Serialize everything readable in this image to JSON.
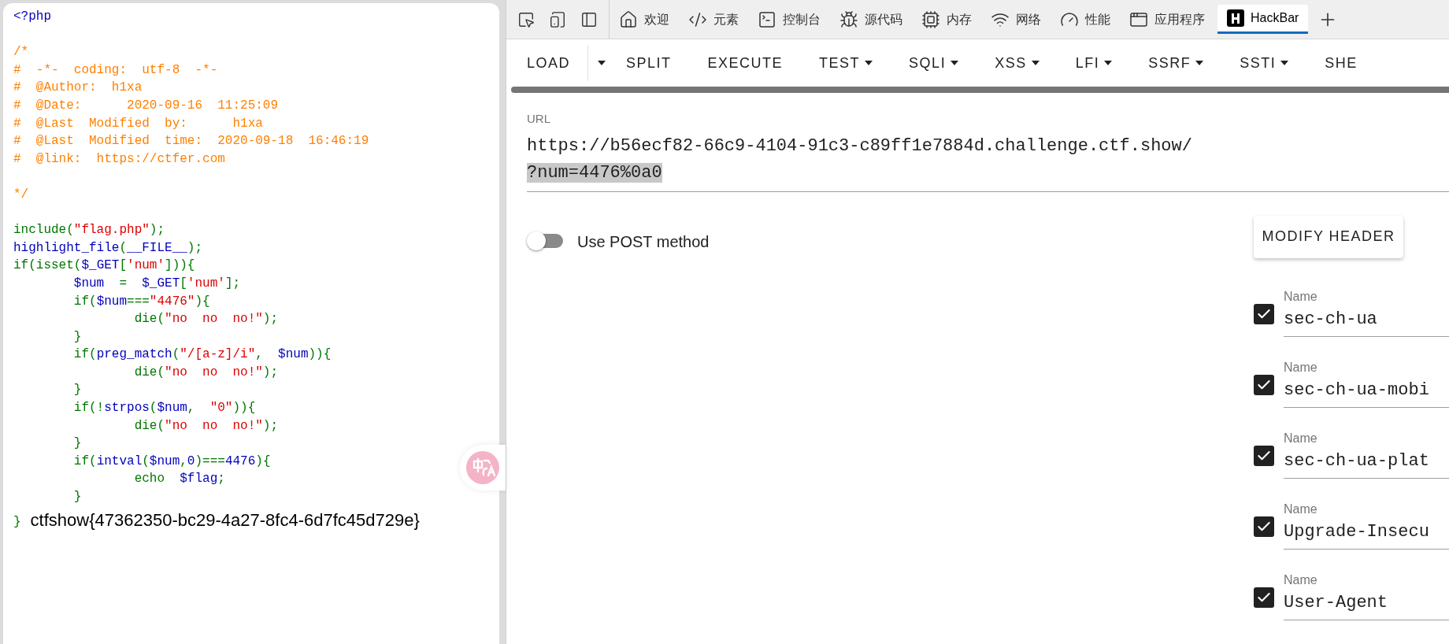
{
  "source": {
    "lines": [
      {
        "kind": "code",
        "tokens": [
          {
            "t": "<?php",
            "kind": "html"
          }
        ]
      },
      {
        "kind": "blank"
      },
      {
        "kind": "code",
        "tokens": [
          {
            "t": "/*",
            "kind": "comment"
          }
        ]
      },
      {
        "kind": "code",
        "tokens": [
          {
            "t": "#  -*-  coding:  utf-8  -*-",
            "kind": "comment"
          }
        ]
      },
      {
        "kind": "code",
        "tokens": [
          {
            "t": "#  @Author:  h1xa",
            "kind": "comment"
          }
        ]
      },
      {
        "kind": "code",
        "tokens": [
          {
            "t": "#  @Date:      2020-09-16  11:25:09",
            "kind": "comment"
          }
        ]
      },
      {
        "kind": "code",
        "tokens": [
          {
            "t": "#  @Last  Modified  by:      h1xa",
            "kind": "comment"
          }
        ]
      },
      {
        "kind": "code",
        "tokens": [
          {
            "t": "#  @Last  Modified  time:  2020-09-18  16:46:19",
            "kind": "comment"
          }
        ]
      },
      {
        "kind": "code",
        "tokens": [
          {
            "t": "#  @link:  https://ctfer.com",
            "kind": "comment"
          }
        ]
      },
      {
        "kind": "blank"
      },
      {
        "kind": "code",
        "tokens": [
          {
            "t": "*/",
            "kind": "comment"
          }
        ]
      },
      {
        "kind": "blank"
      },
      {
        "kind": "code",
        "tokens": [
          {
            "t": "include(",
            "kind": "keyword"
          },
          {
            "t": "\"flag.php\"",
            "kind": "string"
          },
          {
            "t": ");",
            "kind": "keyword"
          }
        ]
      },
      {
        "kind": "code",
        "tokens": [
          {
            "t": "highlight_file",
            "kind": "html"
          },
          {
            "t": "(",
            "kind": "keyword"
          },
          {
            "t": "__FILE__",
            "kind": "html"
          },
          {
            "t": ");",
            "kind": "keyword"
          }
        ]
      },
      {
        "kind": "code",
        "tokens": [
          {
            "t": "if(isset(",
            "kind": "keyword"
          },
          {
            "t": "$_GET",
            "kind": "html"
          },
          {
            "t": "[",
            "kind": "keyword"
          },
          {
            "t": "'num'",
            "kind": "string"
          },
          {
            "t": "])){",
            "kind": "keyword"
          }
        ]
      },
      {
        "kind": "code",
        "tokens": [
          {
            "t": "        $num",
            "kind": "html"
          },
          {
            "t": "  =  ",
            "kind": "keyword"
          },
          {
            "t": "$_GET",
            "kind": "html"
          },
          {
            "t": "[",
            "kind": "keyword"
          },
          {
            "t": "'num'",
            "kind": "string"
          },
          {
            "t": "];",
            "kind": "keyword"
          }
        ]
      },
      {
        "kind": "code",
        "tokens": [
          {
            "t": "        if(",
            "kind": "keyword"
          },
          {
            "t": "$num",
            "kind": "html"
          },
          {
            "t": "===",
            "kind": "keyword"
          },
          {
            "t": "\"4476\"",
            "kind": "string"
          },
          {
            "t": "){",
            "kind": "keyword"
          }
        ]
      },
      {
        "kind": "code",
        "tokens": [
          {
            "t": "                die(",
            "kind": "keyword"
          },
          {
            "t": "\"no  no  no!\"",
            "kind": "string"
          },
          {
            "t": ");",
            "kind": "keyword"
          }
        ]
      },
      {
        "kind": "code",
        "tokens": [
          {
            "t": "        }",
            "kind": "keyword"
          }
        ]
      },
      {
        "kind": "code",
        "tokens": [
          {
            "t": "        if(",
            "kind": "keyword"
          },
          {
            "t": "preg_match",
            "kind": "html"
          },
          {
            "t": "(",
            "kind": "keyword"
          },
          {
            "t": "\"/[a-z]/i\"",
            "kind": "string"
          },
          {
            "t": ",  ",
            "kind": "keyword"
          },
          {
            "t": "$num",
            "kind": "html"
          },
          {
            "t": ")){",
            "kind": "keyword"
          }
        ]
      },
      {
        "kind": "code",
        "tokens": [
          {
            "t": "                die(",
            "kind": "keyword"
          },
          {
            "t": "\"no  no  no!\"",
            "kind": "string"
          },
          {
            "t": ");",
            "kind": "keyword"
          }
        ]
      },
      {
        "kind": "code",
        "tokens": [
          {
            "t": "        }",
            "kind": "keyword"
          }
        ]
      },
      {
        "kind": "code",
        "tokens": [
          {
            "t": "        if(!",
            "kind": "keyword"
          },
          {
            "t": "strpos",
            "kind": "html"
          },
          {
            "t": "(",
            "kind": "keyword"
          },
          {
            "t": "$num",
            "kind": "html"
          },
          {
            "t": ",  ",
            "kind": "keyword"
          },
          {
            "t": "\"0\"",
            "kind": "string"
          },
          {
            "t": ")){",
            "kind": "keyword"
          }
        ]
      },
      {
        "kind": "code",
        "tokens": [
          {
            "t": "                die(",
            "kind": "keyword"
          },
          {
            "t": "\"no  no  no!\"",
            "kind": "string"
          },
          {
            "t": ");",
            "kind": "keyword"
          }
        ]
      },
      {
        "kind": "code",
        "tokens": [
          {
            "t": "        }",
            "kind": "keyword"
          }
        ]
      },
      {
        "kind": "code",
        "tokens": [
          {
            "t": "        if(",
            "kind": "keyword"
          },
          {
            "t": "intval",
            "kind": "html"
          },
          {
            "t": "(",
            "kind": "keyword"
          },
          {
            "t": "$num",
            "kind": "html"
          },
          {
            "t": ",",
            "kind": "keyword"
          },
          {
            "t": "0",
            "kind": "html"
          },
          {
            "t": ")===",
            "kind": "keyword"
          },
          {
            "t": "4476",
            "kind": "html"
          },
          {
            "t": "){",
            "kind": "keyword"
          }
        ]
      },
      {
        "kind": "code",
        "tokens": [
          {
            "t": "                echo  ",
            "kind": "keyword"
          },
          {
            "t": "$flag",
            "kind": "html"
          },
          {
            "t": ";",
            "kind": "keyword"
          }
        ]
      },
      {
        "kind": "code",
        "tokens": [
          {
            "t": "        }",
            "kind": "keyword"
          }
        ]
      }
    ],
    "closing": "}",
    "output": "ctfshow{47362350-bc29-4a27-8fc4-6d7fc45d729e}"
  },
  "devtools_tabs": [
    {
      "label": "欢迎",
      "selected": false
    },
    {
      "label": "元素",
      "selected": false
    },
    {
      "label": "控制台",
      "selected": false
    },
    {
      "label": "源代码",
      "selected": false
    },
    {
      "label": "内存",
      "selected": false
    },
    {
      "label": "网络",
      "selected": false
    },
    {
      "label": "性能",
      "selected": false
    },
    {
      "label": "应用程序",
      "selected": false
    },
    {
      "label": "HackBar",
      "selected": true
    }
  ],
  "hackbar_menu": [
    {
      "label": "LOAD",
      "kind": "split"
    },
    {
      "label": "SPLIT",
      "kind": "plain"
    },
    {
      "label": "EXECUTE",
      "kind": "plain"
    },
    {
      "label": "TEST",
      "kind": "dropdown"
    },
    {
      "label": "SQLI",
      "kind": "dropdown"
    },
    {
      "label": "XSS",
      "kind": "dropdown"
    },
    {
      "label": "LFI",
      "kind": "dropdown"
    },
    {
      "label": "SSRF",
      "kind": "dropdown"
    },
    {
      "label": "SSTI",
      "kind": "dropdown"
    },
    {
      "label": "SHE",
      "kind": "plain"
    }
  ],
  "url": {
    "label": "URL",
    "value": "https://b56ecf82-66c9-4104-91c3-c89ff1e7884d.challenge.ctf.show/",
    "selection": "?num=4476%0a0"
  },
  "post_toggle": {
    "label": "Use POST method",
    "on": false
  },
  "modify_header_button": "MODIFY HEADER",
  "headers": [
    {
      "label": "Name",
      "value": "sec-ch-ua",
      "checked": true
    },
    {
      "label": "Name",
      "value": "sec-ch-ua-mobi",
      "checked": true
    },
    {
      "label": "Name",
      "value": "sec-ch-ua-plat",
      "checked": true
    },
    {
      "label": "Name",
      "value": "Upgrade-Insecu",
      "checked": true
    },
    {
      "label": "Name",
      "value": "User-Agent",
      "checked": true
    }
  ]
}
